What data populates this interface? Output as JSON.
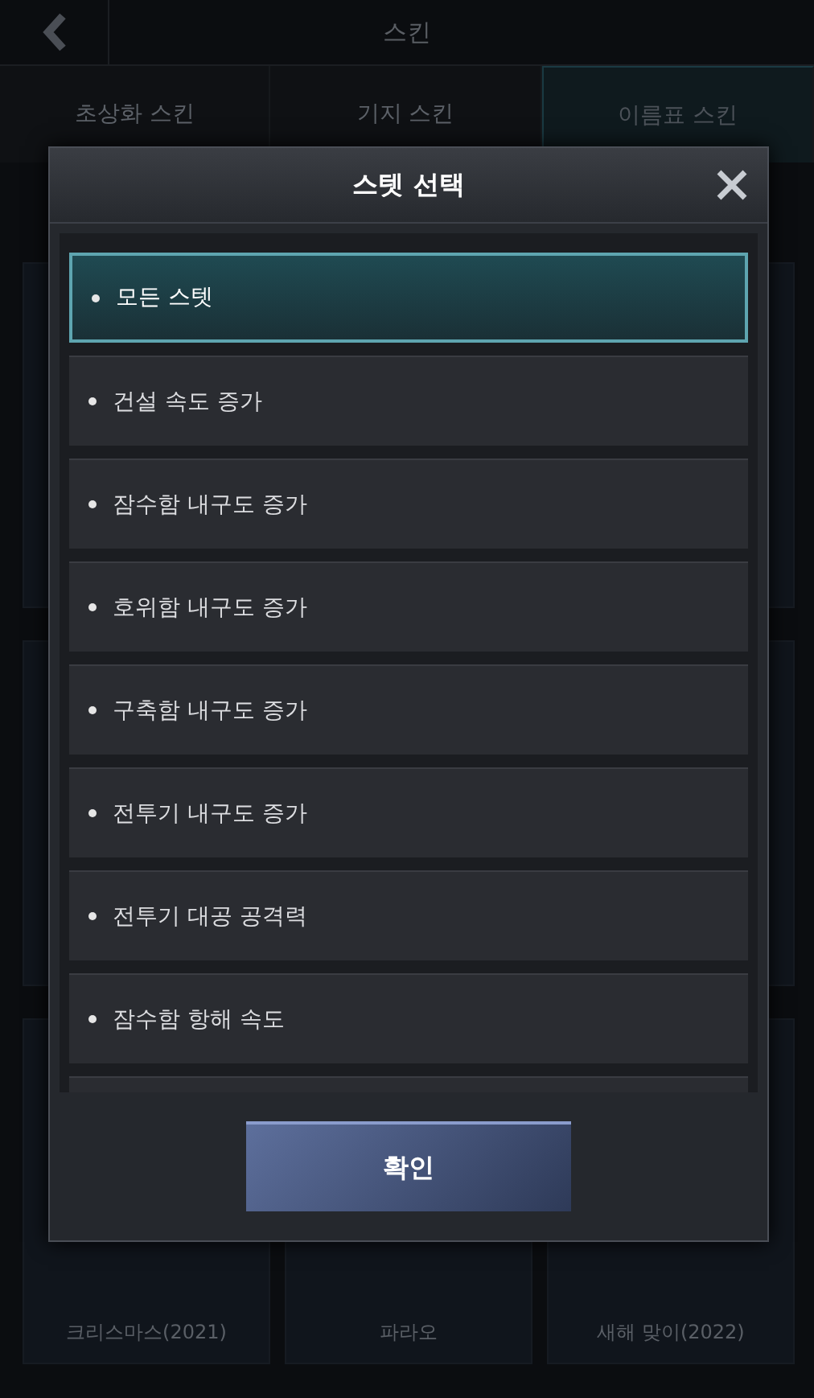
{
  "header": {
    "title": "스킨"
  },
  "tabs": [
    {
      "label": "초상화 스킨",
      "selected": false
    },
    {
      "label": "기지 스킨",
      "selected": false
    },
    {
      "label": "이름표 스킨",
      "selected": true
    }
  ],
  "skin_cards": [
    {
      "name": "크리스마스(2021)"
    },
    {
      "name": "파라오"
    },
    {
      "name": "새해 맞이(2022)"
    }
  ],
  "dialog": {
    "title": "스텟 선택",
    "options": [
      {
        "label": "모든 스텟",
        "selected": true
      },
      {
        "label": "건설 속도 증가",
        "selected": false
      },
      {
        "label": "잠수함 내구도 증가",
        "selected": false
      },
      {
        "label": "호위함 내구도 증가",
        "selected": false
      },
      {
        "label": "구축함 내구도 증가",
        "selected": false
      },
      {
        "label": "전투기 내구도 증가",
        "selected": false
      },
      {
        "label": "전투기 대공 공격력",
        "selected": false
      },
      {
        "label": "잠수함 항해 속도",
        "selected": false
      }
    ],
    "confirm_button": "확인"
  }
}
